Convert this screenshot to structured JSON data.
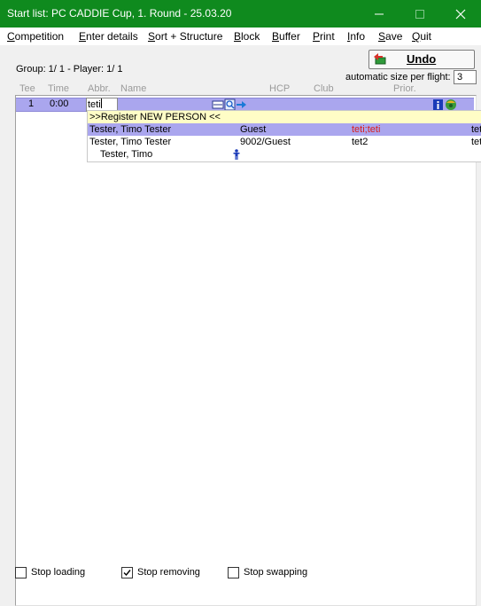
{
  "window": {
    "title": "Start list: PC CADDIE Cup, 1. Round - 25.03.20"
  },
  "menu": [
    {
      "label": "Competition",
      "u": "C",
      "rest": "ompetition"
    },
    {
      "label": "Enter details",
      "u": "E",
      "rest": "nter details"
    },
    {
      "label": "Sort + Structure",
      "u": "S",
      "rest": "ort + Structure"
    },
    {
      "label": "Block",
      "u": "B",
      "rest": "lock"
    },
    {
      "label": "Buffer",
      "u": "B",
      "rest": "uffer"
    },
    {
      "label": "Print",
      "u": "P",
      "rest": "rint"
    },
    {
      "label": "Info",
      "u": "I",
      "rest": "nfo"
    },
    {
      "label": "Save",
      "u": "S",
      "rest": "ave"
    },
    {
      "label": "Quit",
      "u": "Q",
      "rest": "uit"
    }
  ],
  "header": {
    "group_label": "Group:  1/  1 - Player:  1/  1",
    "undo_label": "Undo",
    "autosize_label": "automatic size per flight:",
    "autosize_value": "3"
  },
  "columns": {
    "tee": "Tee",
    "time": "Time",
    "abbr": "Abbr.",
    "name": "Name",
    "hcp": "HCP",
    "club": "Club",
    "prior": "Prior."
  },
  "current_row": {
    "tee": "1",
    "time": "0:00",
    "input_value": "teti"
  },
  "dropdown": {
    "register": ">>Register NEW PERSON <<",
    "rows": [
      {
        "name": "Tester, Timo Tester",
        "club": "Guest",
        "abbr": "teti;teti",
        "extra": "tet",
        "selected": true
      },
      {
        "name": "Tester, Timo Tester",
        "club": "9002/Guest",
        "abbr": "tet2",
        "extra": "tet",
        "selected": false
      },
      {
        "name": "Tester, Timo",
        "club": "",
        "abbr": "",
        "extra": "",
        "selected": false
      }
    ]
  },
  "footer": {
    "stop_loading": {
      "label": "Stop loading",
      "checked": false
    },
    "stop_removing": {
      "label": "Stop removing",
      "checked": true
    },
    "stop_swapping": {
      "label": "Stop swapping",
      "checked": false
    }
  },
  "colors": {
    "titlebar": "#0f8a1e",
    "selection": "#aaa6ee",
    "register_bg": "#fffdc6",
    "abbr_red": "#d81e1e"
  }
}
